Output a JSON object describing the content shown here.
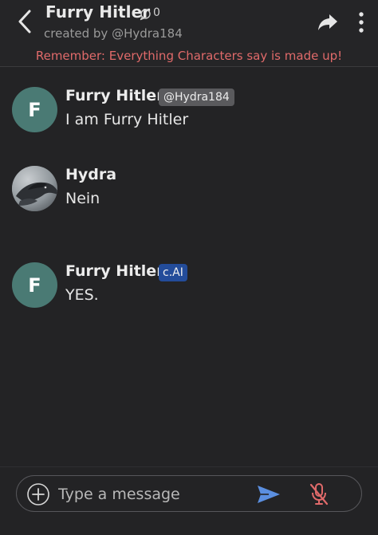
{
  "header": {
    "title": "Furry Hitler",
    "chat_count": "0",
    "created_by": "created by @Hydra184",
    "disclaimer": "Remember: Everything Characters say is made up!",
    "icons": [
      "back-chevron-icon",
      "chat-bubble-icon",
      "share-arrow-icon",
      "more-vertical-icon"
    ]
  },
  "messages": [
    {
      "avatar_letter": "F",
      "name": "Furry Hitler",
      "tag": "@Hydra184",
      "text": "I am Furry Hitler"
    },
    {
      "avatar_icon": "dragon-photo-avatar",
      "name": "Hydra",
      "text": "Nein"
    },
    {
      "avatar_letter": "F",
      "name": "Furry Hitler",
      "tag": "c.AI",
      "text": "YES."
    }
  ],
  "input": {
    "placeholder": "Type a message",
    "icons": [
      "add-circle-icon",
      "send-icon",
      "mic-off-icon"
    ]
  },
  "colors": {
    "background": "#232325",
    "disclaimer": "#e06a6a",
    "avatar": "#4a7a74",
    "cai_badge": "#234c9a",
    "send": "#5b8fe0",
    "mic_off": "#e06a6a"
  }
}
